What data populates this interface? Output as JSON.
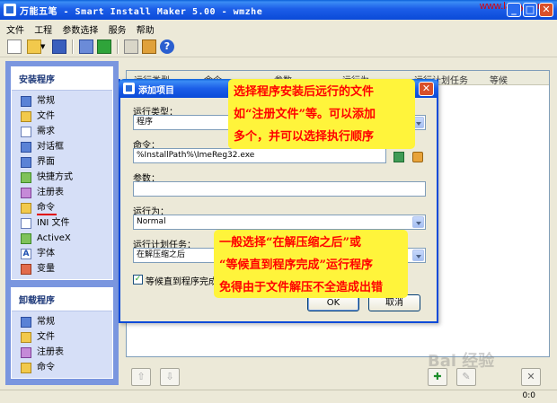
{
  "window": {
    "title": "万能五笔 - Smart Install Maker 5.00 - wmzhe",
    "watermark": "www.lanry.com"
  },
  "menu": [
    "文件",
    "工程",
    "参数选择",
    "服务",
    "帮助"
  ],
  "sidebar": {
    "install_panel": {
      "title": "安装程序",
      "items": [
        {
          "label": "常规",
          "icon": "gear-icon"
        },
        {
          "label": "文件",
          "icon": "folder-icon"
        },
        {
          "label": "需求",
          "icon": "list-icon"
        },
        {
          "label": "对话框",
          "icon": "dialog-icon"
        },
        {
          "label": "界面",
          "icon": "window-icon"
        },
        {
          "label": "快捷方式",
          "icon": "shortcut-icon"
        },
        {
          "label": "注册表",
          "icon": "registry-icon"
        },
        {
          "label": "命令",
          "icon": "command-icon"
        },
        {
          "label": "INI 文件",
          "icon": "ini-file-icon"
        },
        {
          "label": "ActiveX",
          "icon": "activex-icon"
        },
        {
          "label": "字体",
          "icon": "font-icon"
        },
        {
          "label": "变量",
          "icon": "variable-icon"
        }
      ],
      "selected_index": 7
    },
    "uninstall_panel": {
      "title": "卸载程序",
      "items": [
        {
          "label": "常规",
          "icon": "gear-icon"
        },
        {
          "label": "文件",
          "icon": "folder-icon"
        },
        {
          "label": "注册表",
          "icon": "registry-icon"
        },
        {
          "label": "命令",
          "icon": "command-icon"
        }
      ]
    }
  },
  "table": {
    "columns": [
      "运行类型",
      "命令",
      "参数",
      "运行为",
      "运行计划任务",
      "等候"
    ]
  },
  "dialog": {
    "title": "添加项目",
    "run_type_label": "运行类型：",
    "run_type_value": "程序",
    "command_label": "命令：",
    "command_value": "%InstallPath%\\ImeReg32.exe",
    "params_label": "参数：",
    "params_value": "",
    "run_as_label": "运行为：",
    "run_as_value": "Normal",
    "schedule_label": "运行计划任务：",
    "schedule_value": "在解压缩之后",
    "wait_label": "等候直到程序完成",
    "wait_checked": true,
    "ok_label": "OK",
    "cancel_label": "取消"
  },
  "notes": {
    "note1": [
      "选择程序安装后远行的文件",
      "如“注册文件”等。可以添加",
      "多个，并可以选择执行顺序"
    ],
    "note2": [
      "一般选择“在解压缩之后”或",
      "“等候直到程序完成”运行程序",
      "免得由于文件解压不全造成出错"
    ]
  },
  "status": {
    "coord": "0:0"
  },
  "logo_text": "Bai 经验",
  "colors": {
    "title_blue": "#0a4ad8",
    "sidebar_blue": "#7a96df",
    "note_yellow": "#fff43b",
    "note_red": "#ff0000"
  }
}
